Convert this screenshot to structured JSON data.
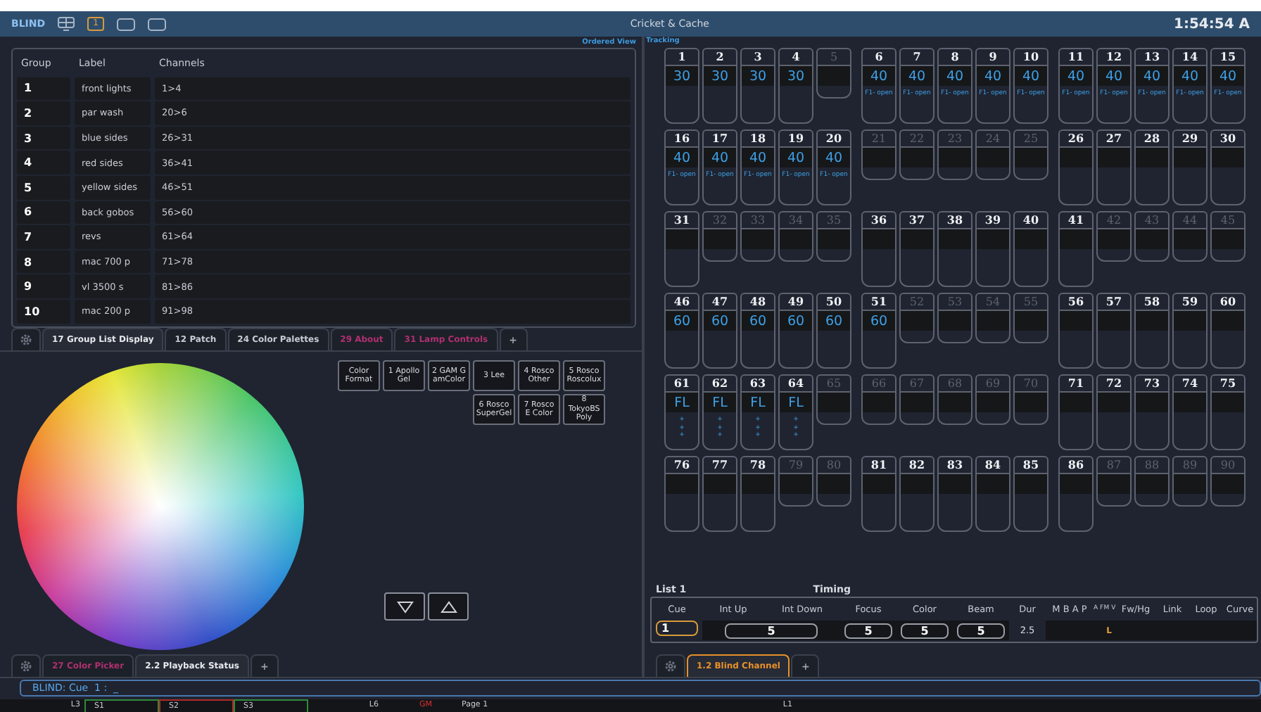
{
  "top_bar": {
    "mode": "BLIND",
    "page_button": "1",
    "title": "Cricket & Cache",
    "clock": "1:54:54 A"
  },
  "group_list": {
    "view_label": "Ordered View",
    "columns": [
      "Group",
      "Label",
      "Channels"
    ],
    "rows": [
      {
        "group": "1",
        "label": "front lights",
        "channels": "1>4"
      },
      {
        "group": "2",
        "label": "par wash",
        "channels": "20>6"
      },
      {
        "group": "3",
        "label": "blue sides",
        "channels": "26>31"
      },
      {
        "group": "4",
        "label": "red sides",
        "channels": "36>41"
      },
      {
        "group": "5",
        "label": "yellow sides",
        "channels": "46>51"
      },
      {
        "group": "6",
        "label": "back gobos",
        "channels": "56>60"
      },
      {
        "group": "7",
        "label": "revs",
        "channels": "61>64"
      },
      {
        "group": "8",
        "label": "mac 700 p",
        "channels": "71>78"
      },
      {
        "group": "9",
        "label": "vl 3500 s",
        "channels": "81>86"
      },
      {
        "group": "10",
        "label": "mac 200 p",
        "channels": "91>98"
      }
    ]
  },
  "left_tabs": {
    "add": "+",
    "tabs": [
      {
        "label": "17 Group List Display",
        "selected": true,
        "kind": "normal"
      },
      {
        "label": "12 Patch",
        "selected": false,
        "kind": "normal"
      },
      {
        "label": "24 Color Palettes",
        "selected": false,
        "kind": "normal"
      },
      {
        "label": "29 About",
        "selected": false,
        "kind": "alert"
      },
      {
        "label": "31 Lamp Controls",
        "selected": false,
        "kind": "alert"
      }
    ]
  },
  "color_picker": {
    "buttons": [
      [
        "Color Format",
        "1 Apollo Gel",
        "2 GAM G amColor",
        "3 Lee",
        "4 Rosco Other",
        "5 Rosco Roscolux"
      ],
      [
        "6 Rosco SuperGel",
        "7 Rosco E Color",
        "8 TokyoBS Poly"
      ]
    ]
  },
  "bottom_left_tabs": {
    "add": "+",
    "tabs": [
      {
        "label": "27 Color Picker",
        "selected": false,
        "kind": "alert"
      },
      {
        "label": "2.2 Playback Status",
        "selected": true,
        "kind": "normal"
      }
    ]
  },
  "channel_grid": {
    "mode_label": "Tracking",
    "channels": [
      {
        "number": "1",
        "patched": true,
        "value": "30"
      },
      {
        "number": "2",
        "patched": true,
        "value": "30"
      },
      {
        "number": "3",
        "patched": true,
        "value": "30"
      },
      {
        "number": "4",
        "patched": true,
        "value": "30"
      },
      {
        "number": "5",
        "patched": false
      },
      {
        "number": "6",
        "patched": true,
        "value": "40",
        "notes": [
          "F1- open"
        ]
      },
      {
        "number": "7",
        "patched": true,
        "value": "40",
        "notes": [
          "F1- open"
        ]
      },
      {
        "number": "8",
        "patched": true,
        "value": "40",
        "notes": [
          "F1- open"
        ]
      },
      {
        "number": "9",
        "patched": true,
        "value": "40",
        "notes": [
          "F1- open"
        ]
      },
      {
        "number": "10",
        "patched": true,
        "value": "40",
        "notes": [
          "F1- open"
        ]
      },
      {
        "number": "11",
        "patched": true,
        "value": "40",
        "notes": [
          "F1- open"
        ]
      },
      {
        "number": "12",
        "patched": true,
        "value": "40",
        "notes": [
          "F1- open"
        ]
      },
      {
        "number": "13",
        "patched": true,
        "value": "40",
        "notes": [
          "F1- open"
        ]
      },
      {
        "number": "14",
        "patched": true,
        "value": "40",
        "notes": [
          "F1- open"
        ]
      },
      {
        "number": "15",
        "patched": true,
        "value": "40",
        "notes": [
          "F1- open"
        ]
      },
      {
        "number": "16",
        "patched": true,
        "value": "40",
        "notes": [
          "F1- open"
        ]
      },
      {
        "number": "17",
        "patched": true,
        "value": "40",
        "notes": [
          "F1- open"
        ]
      },
      {
        "number": "18",
        "patched": true,
        "value": "40",
        "notes": [
          "F1- open"
        ]
      },
      {
        "number": "19",
        "patched": true,
        "value": "40",
        "notes": [
          "F1- open"
        ]
      },
      {
        "number": "20",
        "patched": true,
        "value": "40",
        "notes": [
          "F1- open"
        ]
      },
      {
        "number": "21",
        "patched": false
      },
      {
        "number": "22",
        "patched": false
      },
      {
        "number": "23",
        "patched": false
      },
      {
        "number": "24",
        "patched": false
      },
      {
        "number": "25",
        "patched": false
      },
      {
        "number": "26",
        "patched": true
      },
      {
        "number": "27",
        "patched": true
      },
      {
        "number": "28",
        "patched": true
      },
      {
        "number": "29",
        "patched": true
      },
      {
        "number": "30",
        "patched": true
      },
      {
        "number": "31",
        "patched": true
      },
      {
        "number": "32",
        "patched": false
      },
      {
        "number": "33",
        "patched": false
      },
      {
        "number": "34",
        "patched": false
      },
      {
        "number": "35",
        "patched": false
      },
      {
        "number": "36",
        "patched": true
      },
      {
        "number": "37",
        "patched": true
      },
      {
        "number": "38",
        "patched": true
      },
      {
        "number": "39",
        "patched": true
      },
      {
        "number": "40",
        "patched": true
      },
      {
        "number": "41",
        "patched": true
      },
      {
        "number": "42",
        "patched": false
      },
      {
        "number": "43",
        "patched": false
      },
      {
        "number": "44",
        "patched": false
      },
      {
        "number": "45",
        "patched": false
      },
      {
        "number": "46",
        "patched": true,
        "value": "60"
      },
      {
        "number": "47",
        "patched": true,
        "value": "60"
      },
      {
        "number": "48",
        "patched": true,
        "value": "60"
      },
      {
        "number": "49",
        "patched": true,
        "value": "60"
      },
      {
        "number": "50",
        "patched": true,
        "value": "60"
      },
      {
        "number": "51",
        "patched": true,
        "value": "60"
      },
      {
        "number": "52",
        "patched": false
      },
      {
        "number": "53",
        "patched": false
      },
      {
        "number": "54",
        "patched": false
      },
      {
        "number": "55",
        "patched": false
      },
      {
        "number": "56",
        "patched": true
      },
      {
        "number": "57",
        "patched": true
      },
      {
        "number": "58",
        "patched": true
      },
      {
        "number": "59",
        "patched": true
      },
      {
        "number": "60",
        "patched": true
      },
      {
        "number": "61",
        "patched": true,
        "value": "FL",
        "notes": [
          "+",
          "+",
          "+"
        ]
      },
      {
        "number": "62",
        "patched": true,
        "value": "FL",
        "notes": [
          "+",
          "+",
          "+"
        ]
      },
      {
        "number": "63",
        "patched": true,
        "value": "FL",
        "notes": [
          "+",
          "+",
          "+"
        ]
      },
      {
        "number": "64",
        "patched": true,
        "value": "FL",
        "notes": [
          "+",
          "+",
          "+"
        ]
      },
      {
        "number": "65",
        "patched": false
      },
      {
        "number": "66",
        "patched": false
      },
      {
        "number": "67",
        "patched": false
      },
      {
        "number": "68",
        "patched": false
      },
      {
        "number": "69",
        "patched": false
      },
      {
        "number": "70",
        "patched": false
      },
      {
        "number": "71",
        "patched": true
      },
      {
        "number": "72",
        "patched": true
      },
      {
        "number": "73",
        "patched": true
      },
      {
        "number": "74",
        "patched": true
      },
      {
        "number": "75",
        "patched": true
      },
      {
        "number": "76",
        "patched": true
      },
      {
        "number": "77",
        "patched": true
      },
      {
        "number": "78",
        "patched": true
      },
      {
        "number": "79",
        "patched": false
      },
      {
        "number": "80",
        "patched": false
      },
      {
        "number": "81",
        "patched": true
      },
      {
        "number": "82",
        "patched": true
      },
      {
        "number": "83",
        "patched": true
      },
      {
        "number": "84",
        "patched": true
      },
      {
        "number": "85",
        "patched": true
      },
      {
        "number": "86",
        "patched": true
      },
      {
        "number": "87",
        "patched": false
      },
      {
        "number": "88",
        "patched": false
      },
      {
        "number": "89",
        "patched": false
      },
      {
        "number": "90",
        "patched": false
      }
    ]
  },
  "cue_list": {
    "title": "List 1",
    "timing_label": "Timing",
    "columns": [
      "Cue",
      "Int Up",
      "Int Down",
      "Focus",
      "Color",
      "Beam",
      "Dur",
      "M B A P",
      "A F",
      "M V",
      "Fw/Hg",
      "Link",
      "Loop",
      "Curve"
    ],
    "row": {
      "cue": "1",
      "intensity": "5",
      "focus": "5",
      "color_time": "5",
      "beam": "5",
      "duration": "2.5",
      "flags": "L"
    }
  },
  "right_tabs": {
    "add": "+",
    "tabs": [
      {
        "label": "1.2 Blind Channel",
        "selected": true
      }
    ]
  },
  "command_line": "BLIND: Cue  1 :  _",
  "fader_strip": [
    {
      "label": "L3",
      "kind": "label"
    },
    {
      "label": "S1",
      "kind": "slot",
      "color": "#2f8a3a"
    },
    {
      "label": "S2",
      "kind": "slot",
      "color": "#b02a2a"
    },
    {
      "label": "S3",
      "kind": "slot",
      "color": "#2f8a3a"
    },
    {
      "label": "L6",
      "kind": "label"
    },
    {
      "label": "GM",
      "kind": "alert"
    },
    {
      "label": "Page 1",
      "kind": "page"
    },
    {
      "label": "L1",
      "kind": "label"
    }
  ]
}
